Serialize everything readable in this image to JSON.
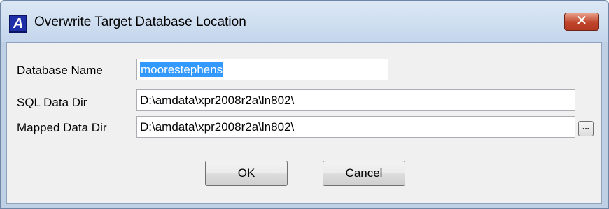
{
  "window": {
    "title": "Overwrite Target Database Location",
    "app_icon_letter": "A",
    "close_glyph": "✕"
  },
  "form": {
    "database_name_label": "Database Name",
    "database_name_value": "moorestephens",
    "sql_data_dir_label": "SQL Data Dir",
    "sql_data_dir_value": "D:\\amdata\\xpr2008r2a\\ln802\\",
    "mapped_data_dir_label": "Mapped Data Dir",
    "mapped_data_dir_value": "D:\\amdata\\xpr2008r2a\\ln802\\",
    "browse_label": "..."
  },
  "buttons": {
    "ok_mnemonic": "O",
    "ok_rest": "K",
    "cancel_mnemonic": "C",
    "cancel_rest": "ancel"
  },
  "colors": {
    "selection": "#3399ff",
    "close_button": "#c0442a",
    "app_icon": "#1f2fa8"
  },
  "icons": {
    "app": "app-logo-icon",
    "close": "close-icon",
    "browse": "ellipsis-icon"
  }
}
